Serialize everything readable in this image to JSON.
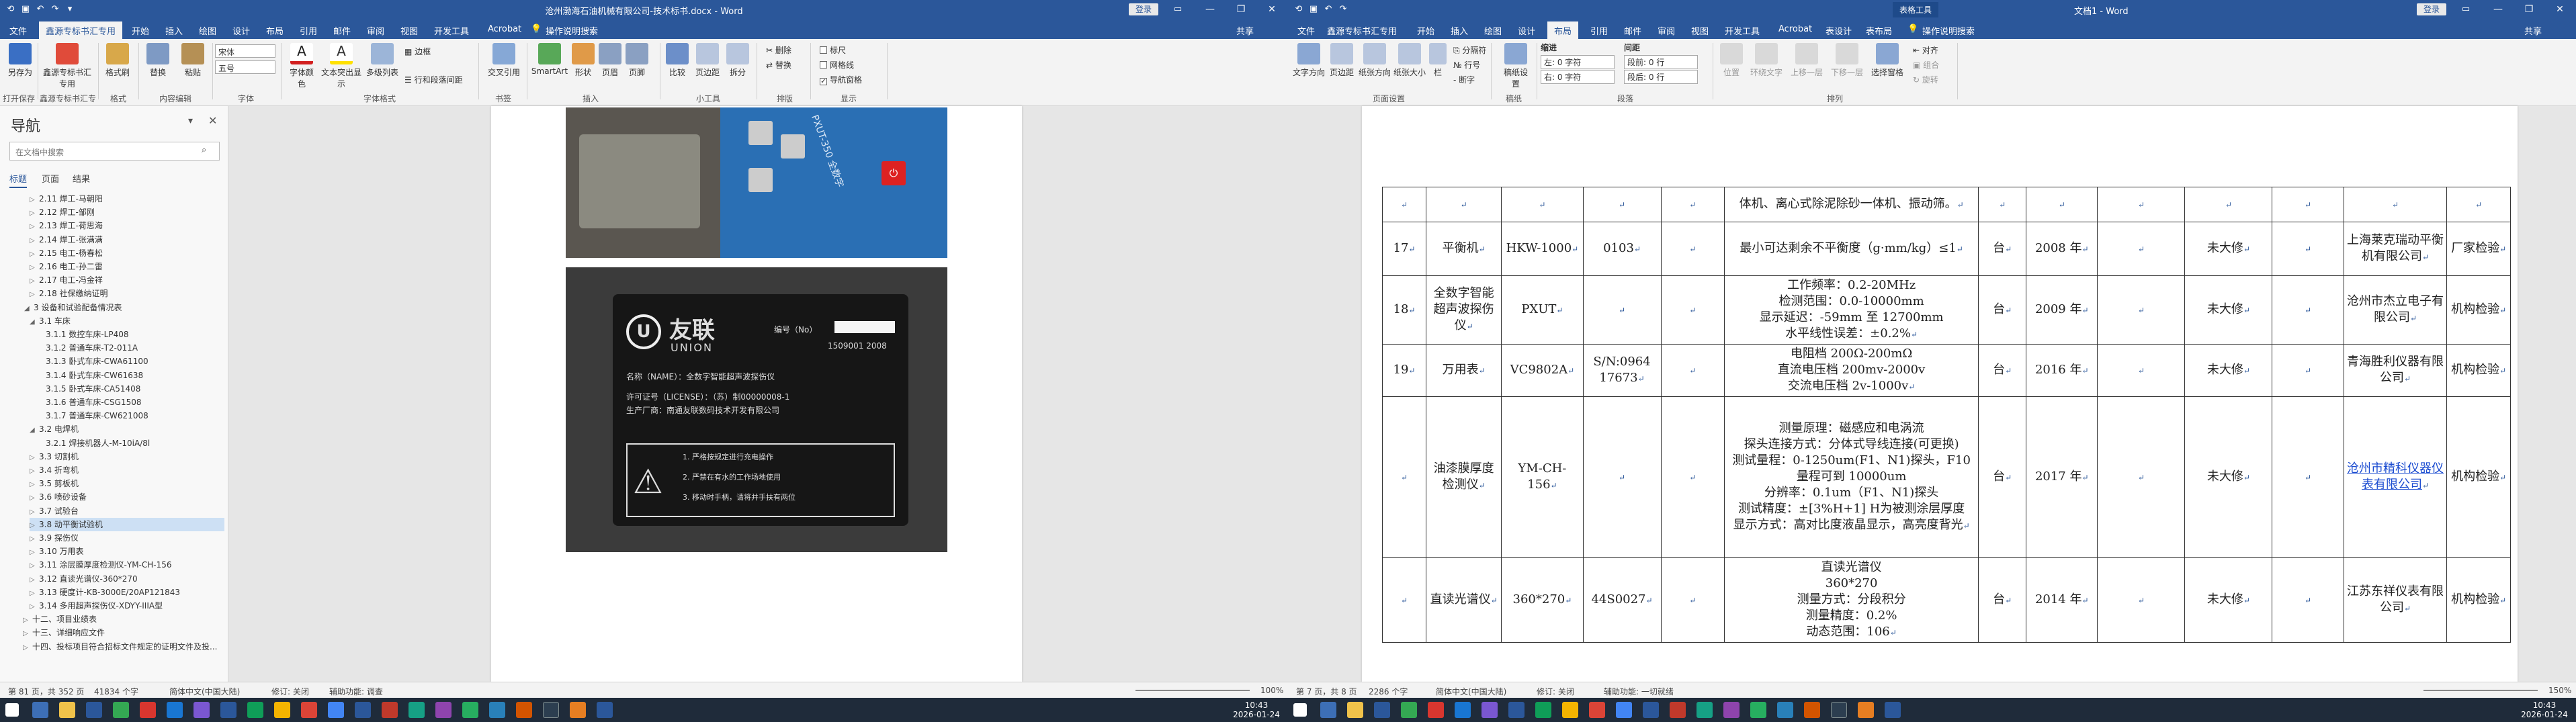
{
  "left_window": {
    "title": "沧州渤海石油机械有限公司-技术标书.docx - Word",
    "share_btn": "登录",
    "tabs": [
      "文件",
      "鑫源专标书汇专用",
      "开始",
      "插入",
      "绘图",
      "设计",
      "布局",
      "引用",
      "邮件",
      "审阅",
      "视图",
      "开发工具",
      "Acrobat",
      "操作说明搜索"
    ],
    "share": "共享",
    "ribbon": {
      "groups": [
        "打开保存",
        "鑫源专标书汇专用",
        "格式",
        "内容编辑",
        "字体",
        "字体格式",
        "字段",
        "书签",
        "插入",
        "小工具",
        "排版",
        "显示"
      ],
      "buttons": [
        "另存为",
        "鑫源专标书汇专用",
        "格式刷",
        "替换",
        "粘贴",
        "宋体",
        "五号",
        "字体颜色",
        "文本突出显示",
        "多级列表",
        "边框",
        "行和段落间距",
        "交叉引用",
        "SmartArt",
        "形状",
        "页眉",
        "页脚",
        "比较",
        "页边距",
        "拆分",
        "删除",
        "替换",
        "标尺",
        "网格线",
        "导航窗格"
      ],
      "font_name": "宋体",
      "font_size": "五号"
    },
    "nav": {
      "title": "导航",
      "search_placeholder": "在文档中搜索",
      "tabs": [
        "标题",
        "页面",
        "结果"
      ],
      "items": [
        "2.11 焊工-马朝阳",
        "2.12 焊工-邹刚",
        "2.13 焊工-荷思海",
        "2.14 焊工-张满满",
        "2.15 电工-杨春松",
        "2.16 电工-孙二雷",
        "2.17 电工-冯金祥",
        "2.18 社保缴纳证明",
        "3 设备和试验配备情况表",
        "3.1 车床",
        "3.1.1 数控车床-LP408",
        "3.1.2 普通车床-T2-011A",
        "3.1.3 卧式车床-CWA61100",
        "3.1.4 卧式车床-CW61638",
        "3.1.5 卧式车床-CA51408",
        "3.1.6 普通车床-CSG1508",
        "3.1.7 普通车床-CW621008",
        "3.2 电焊机",
        "3.2.1 焊接机器人-M-10iA/8l",
        "3.3 切割机",
        "3.4 折弯机",
        "3.5 剪板机",
        "3.6 喷砂设备",
        "3.7 试验台",
        "3.8 动平衡试验机",
        "3.9 探伤仪",
        "3.10 万用表",
        "3.11 涂层膜厚度检测仪-YM-CH-156",
        "3.12 直读光谱仪-360*270",
        "3.13 硬度计-KB-3000E/20AP121843",
        "3.14 多用超声探伤仪-XDYY-IIIA型",
        "十二、项目业绩表",
        "十三、详细响应文件",
        "十四、投标项目符合招标文件规定的证明文件及投..."
      ]
    },
    "photo_plate": {
      "brand": "友联",
      "brand_en": "UNION",
      "num_label": "编号（No）",
      "num": "1509001 2008",
      "name_line": "名称（NAME）：全数字智能超声波探伤仪",
      "license": "许可证号（LICENSE）：（苏）制00000008-1",
      "maker": "生产厂商：南通友联数码技术开发有限公司",
      "warn": [
        "1. 严格按规定进行充电操作",
        "2. 严禁在有水的工作场地使用",
        "3. 移动时手柄，请将并手扶有两位"
      ],
      "unit": "PXUT-350 全数字"
    },
    "status": {
      "page": "第 81 页，共 352 页",
      "words": "41834 个字",
      "lang": "简体中文(中国大陆)",
      "track": "修订: 关闭",
      "assist": "辅助功能: 调查",
      "zoom": "100%"
    }
  },
  "right_window": {
    "title": "文档1 - Word",
    "context": "表格工具",
    "share_btn": "登录",
    "tabs": [
      "文件",
      "鑫源专标书汇专用",
      "开始",
      "插入",
      "绘图",
      "设计",
      "布局",
      "引用",
      "邮件",
      "审阅",
      "视图",
      "开发工具",
      "Acrobat",
      "表设计",
      "表布局",
      "操作说明搜索"
    ],
    "share": "共享",
    "ribbon": {
      "groups": [
        "页面设置",
        "稿纸",
        "段落",
        "排列"
      ],
      "buttons": [
        "文字方向",
        "页边距",
        "纸张方向",
        "纸张大小",
        "栏",
        "分隔符",
        "行号",
        "断字",
        "稿纸设置",
        "缩进",
        "间距",
        "位置",
        "环绕文字",
        "上移一层",
        "下移一层",
        "选择窗格",
        "对齐",
        "组合",
        "旋转"
      ],
      "indent_left": "左: 0 字符",
      "indent_right": "右: 0 字符",
      "space_before": "段前: 0 行",
      "space_after": "段后: 0 行",
      "labels": [
        "缩进",
        "间距"
      ]
    },
    "table": {
      "rows": [
        {
          "no": "",
          "name": "",
          "model": "",
          "serial": "",
          "spec": "体机、离心式除泥除砂一体机、振动筛。",
          "unit": "",
          "year": "",
          "qty": "",
          "status": "",
          "own": "",
          "maker": "",
          "source": ""
        },
        {
          "no": "17",
          "name": "平衡机",
          "model": "HKW-1000",
          "serial": "0103",
          "spec": "最小可达剩余不平衡度（g·mm/kg）≤1",
          "unit": "台",
          "year": "2008 年",
          "qty": "",
          "status": "未大修",
          "own": "",
          "maker": "上海莱克瑞动平衡机有限公司",
          "source": "厂家检验"
        },
        {
          "no": "18",
          "name": "全数字智能超声波探伤仪",
          "model": "PXUT",
          "serial": "",
          "spec": "工作频率：0.2-20MHz\n检测范围：0.0-10000mm\n显示延迟：-59mm 至 12700mm\n水平线性误差：±0.2%",
          "unit": "台",
          "year": "2009 年",
          "qty": "",
          "status": "未大修",
          "own": "",
          "maker": "沧州市杰立电子有限公司",
          "source": "机构检验"
        },
        {
          "no": "19",
          "name": "万用表",
          "model": "VC9802A",
          "serial": "S/N:0964 17673",
          "spec": "电阻档 200Ω-200mΩ\n直流电压档 200mv-2000v\n交流电压档 2v-1000v",
          "unit": "台",
          "year": "2016 年",
          "qty": "",
          "status": "未大修",
          "own": "",
          "maker": "青海胜利仪器有限公司",
          "source": "机构检验"
        },
        {
          "no": "",
          "name": "油漆膜厚度检测仪",
          "model": "YM-CH-156",
          "serial": "",
          "spec": "测量原理：磁感应和电涡流\n探头连接方式：分体式导线连接(可更换)\n测试量程：0-1250um(F1、N1)探头，F10 量程可到 10000um\n分辨率：0.1um（F1、N1)探头\n测试精度：±[3%H+1] H为被测涂层厚度\n显示方式：高对比度液晶显示，高亮度背光",
          "unit": "台",
          "year": "2017 年",
          "qty": "",
          "status": "未大修",
          "own": "",
          "maker": "沧州市精科仪器仪表有限公司",
          "source": "机构检验"
        },
        {
          "no": "",
          "name": "直读光谱仪",
          "model": "360*270",
          "serial": "44S0027",
          "spec": "直读光谱仪\n360*270\n测量方式：分段积分\n测量精度：0.2%\n动态范围：106",
          "unit": "台",
          "year": "2014 年",
          "qty": "",
          "status": "未大修",
          "own": "",
          "maker": "江苏东祥仪表有限公司",
          "source": "机构检验"
        }
      ]
    },
    "status": {
      "page": "第 7 页，共 8 页",
      "words": "2286 个字",
      "lang": "简体中文(中国大陆)",
      "track": "修订: 关闭",
      "assist": "辅助功能: 一切就绪",
      "zoom": "150%"
    }
  },
  "clock": {
    "time": "10:43",
    "date": "2026-01-24"
  },
  "colors": {
    "word_blue": "#2b579a",
    "taskbar": "#1f2b3a",
    "nav_sel": "#cde0f4"
  }
}
